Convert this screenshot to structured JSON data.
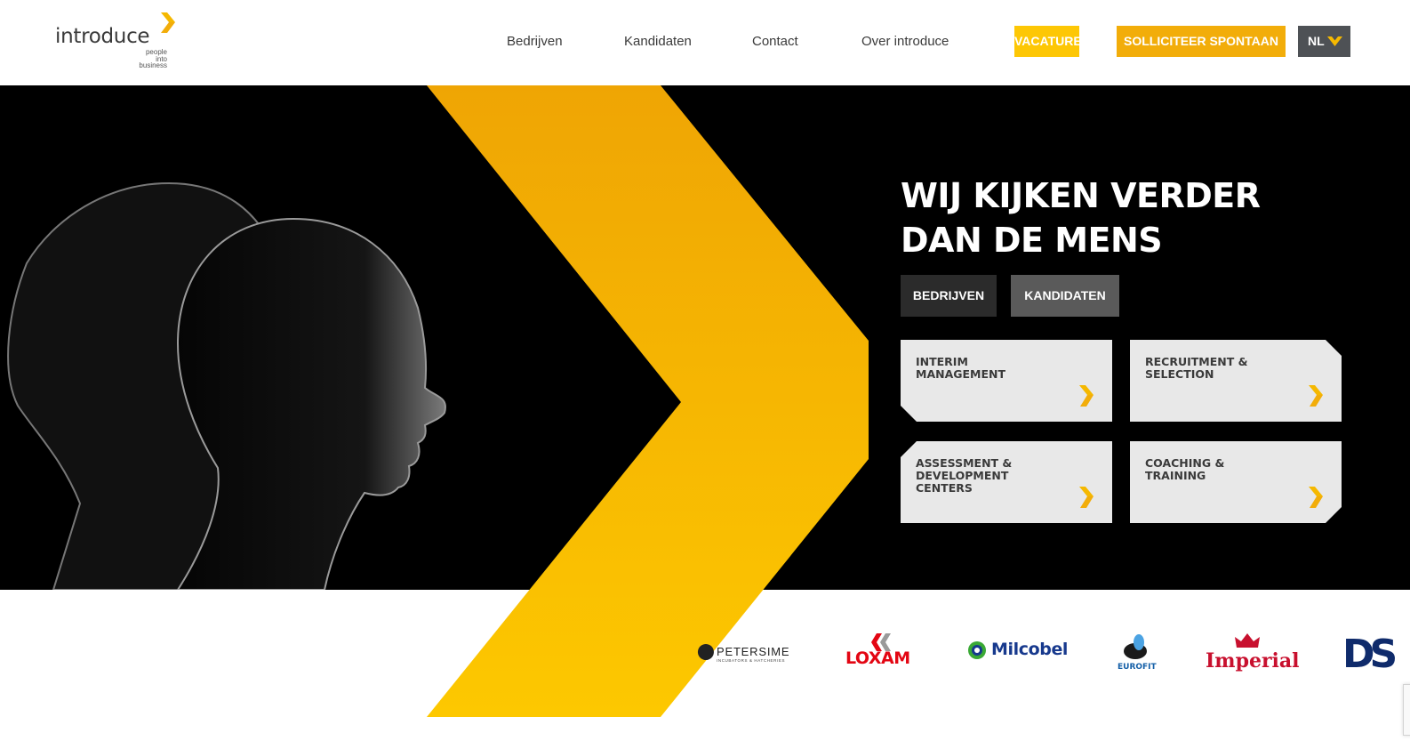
{
  "brand": {
    "name": "introduce",
    "tagline_lines": [
      "people",
      "into",
      "business"
    ],
    "accent": "#f5b800",
    "accent_dark": "#f2ad0a"
  },
  "nav": {
    "items": [
      "Bedrijven",
      "Kandidaten",
      "Contact",
      "Over introduce"
    ],
    "vacatures": "VACATURES",
    "solliciteer": "SOLLICITEER SPONTAAN",
    "language": "NL"
  },
  "hero": {
    "title_line1": "WIJ KIJKEN VERDER",
    "title_line2": "DAN DE MENS",
    "button_bedrijven": "BEDRIJVEN",
    "button_kandidaten": "KANDIDATEN"
  },
  "services": [
    {
      "line1": "INTERIM",
      "line2": "MANAGEMENT",
      "line3": ""
    },
    {
      "line1": "RECRUITMENT &",
      "line2": "SELECTION",
      "line3": ""
    },
    {
      "line1": "ASSESSMENT &",
      "line2": "DEVELOPMENT",
      "line3": "CENTERS"
    },
    {
      "line1": "COACHING &",
      "line2": "TRAINING",
      "line3": ""
    }
  ],
  "clients": {
    "petersime": "PETERSIME",
    "petersime_sub": "INCUBATORS & HATCHERIES",
    "loxam": "LOXAM",
    "milcobel": "Milcobel",
    "eurofit": "EUROFIT",
    "imperial": "Imperial",
    "ds": "DS"
  },
  "icons": {
    "logo_mark": "introduce-chevron-icon",
    "lang_chevron": "chevron-down-icon",
    "tile_icon": "introduce-chevron-icon"
  }
}
